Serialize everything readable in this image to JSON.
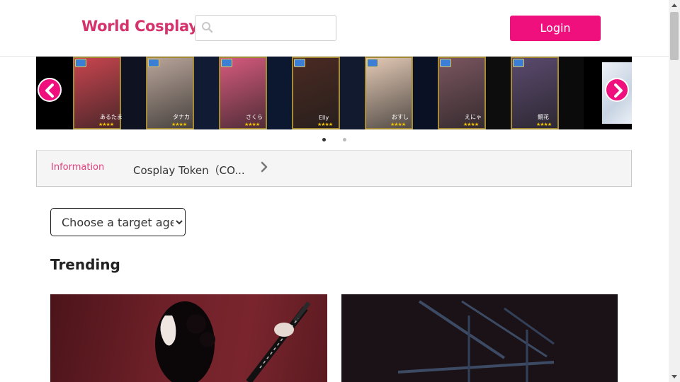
{
  "header": {
    "logo": "World Cosplay",
    "search": {
      "placeholder": "",
      "value": ""
    },
    "login_label": "Login"
  },
  "carousel": {
    "slides": [
      {
        "name": "あるたま",
        "stars": "★★★★",
        "bg": "#0f1220",
        "photo": "#c8454f"
      },
      {
        "name": "タナカ",
        "stars": "★★★★",
        "bg": "#111c34",
        "photo": "#b9a59a"
      },
      {
        "name": "さくら",
        "stars": "★★★★",
        "bg": "#0c1730",
        "photo": "#d55a7d"
      },
      {
        "name": "Elly",
        "stars": "★★★★",
        "bg": "#121a30",
        "photo": "#4a2a22"
      },
      {
        "name": "おすし",
        "stars": "★★★★",
        "bg": "#0a1124",
        "photo": "#e3c9b5"
      },
      {
        "name": "えにゃ",
        "stars": "★★★★",
        "bg": "#0d0d0d",
        "photo": "#7a5560"
      },
      {
        "name": "鏡花",
        "stars": "★★★★",
        "bg": "#0b0b0b",
        "photo": "#5b4a6e"
      }
    ],
    "pagination": {
      "active": 1,
      "total": 2
    }
  },
  "info": {
    "label": "Information",
    "text": "Cosplay Token（CO..."
  },
  "filter": {
    "selected": "Choose a target age"
  },
  "trending": {
    "title": "Trending"
  },
  "colors": {
    "brand": "#f0107d",
    "logo": "#d6336c",
    "info_label": "#e2407f"
  }
}
